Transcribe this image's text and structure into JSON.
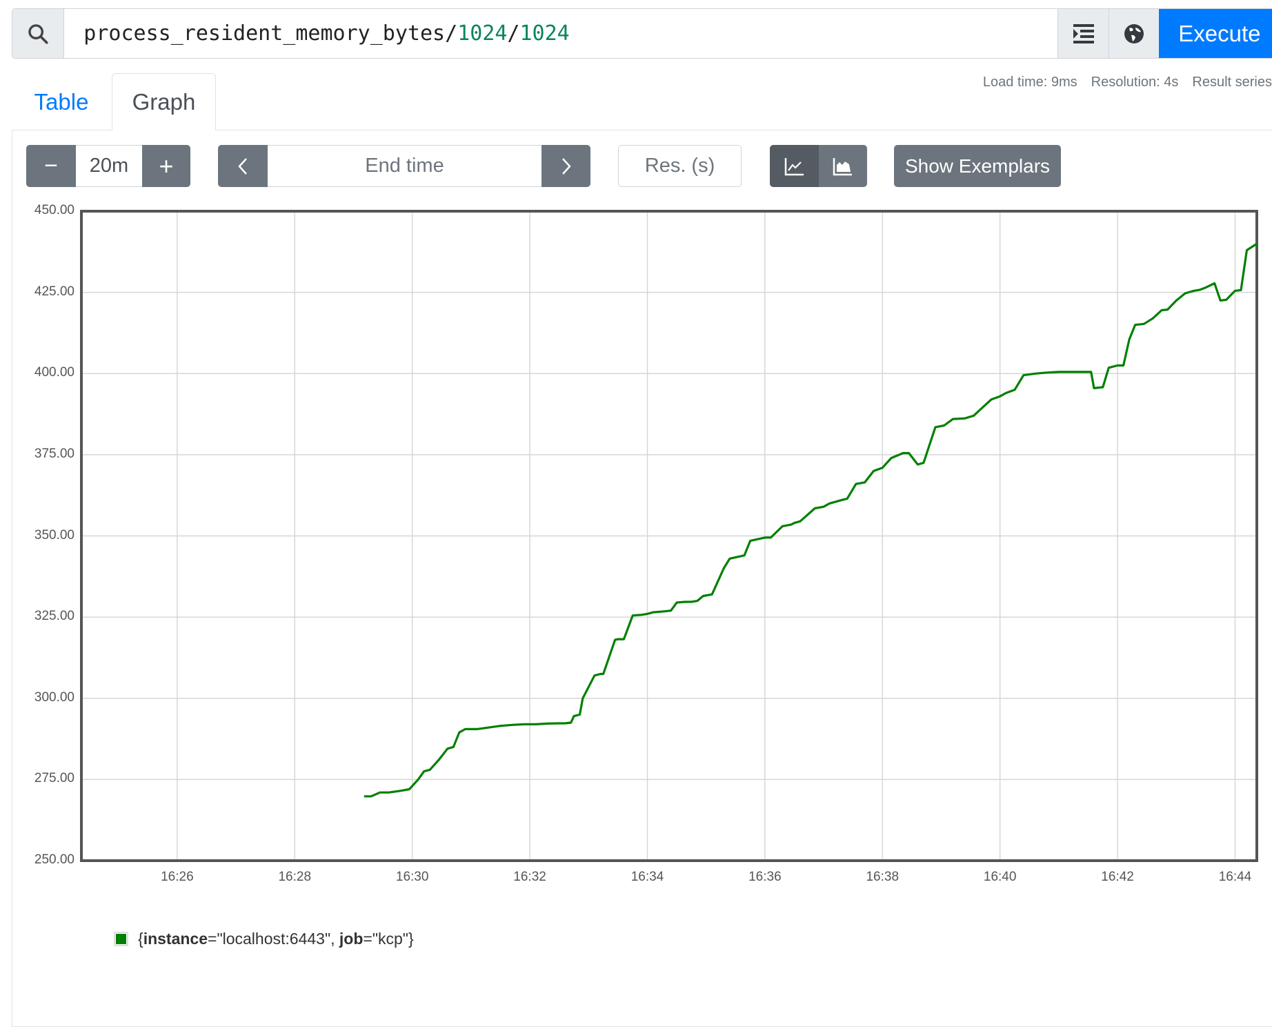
{
  "query": {
    "metric": "process_resident_memory_bytes",
    "op1": "/",
    "num1": "1024",
    "op2": "/",
    "num2": "1024",
    "execute_label": "Execute",
    "icons": [
      "search-icon",
      "format-icon",
      "globe-icon"
    ]
  },
  "stats": {
    "load_time": "Load time: 9ms",
    "resolution": "Resolution: 4s",
    "result_series": "Result series"
  },
  "tabs": [
    {
      "label": "Table",
      "active": false
    },
    {
      "label": "Graph",
      "active": true
    }
  ],
  "toolbar": {
    "range_minus": "−",
    "range_value": "20m",
    "range_plus": "+",
    "prev": "‹",
    "end_time_placeholder": "End time",
    "next": "›",
    "res_placeholder": "Res. (s)",
    "show_exemplars": "Show Exemplars",
    "chart_modes": [
      "line-chart-icon",
      "stacked-area-icon"
    ]
  },
  "legend": {
    "color": "#008000",
    "open": "{",
    "k1": "instance",
    "v1": "=\"localhost:6443\", ",
    "k2": "job",
    "v2": "=\"kcp\"}"
  },
  "chart_data": {
    "type": "line",
    "title": "",
    "xlabel": "",
    "ylabel": "",
    "ylim": [
      250,
      450
    ],
    "yticks": [
      "450.00",
      "425.00",
      "400.00",
      "375.00",
      "350.00",
      "325.00",
      "300.00",
      "275.00",
      "250.00"
    ],
    "xlim_minutes": [
      984.37,
      1004.37
    ],
    "xticks": [
      "16:26",
      "16:28",
      "16:30",
      "16:32",
      "16:34",
      "16:36",
      "16:38",
      "16:40",
      "16:42",
      "16:44"
    ],
    "grid": true,
    "series": [
      {
        "name": "{instance=\"localhost:6443\", job=\"kcp\"}",
        "color": "#008000",
        "x_minutes": [
          989.18,
          989.3,
          989.45,
          989.6,
          989.8,
          989.95,
          990.1,
          990.2,
          990.3,
          990.45,
          990.6,
          990.7,
          990.8,
          990.9,
          991.1,
          991.3,
          991.5,
          991.7,
          991.9,
          992.1,
          992.3,
          992.5,
          992.6,
          992.7,
          992.75,
          992.85,
          992.9,
          993.1,
          993.2,
          993.25,
          993.45,
          993.5,
          993.6,
          993.75,
          993.9,
          994.0,
          994.1,
          994.3,
          994.4,
          994.5,
          994.65,
          994.75,
          994.85,
          994.95,
          995.1,
          995.3,
          995.4,
          995.65,
          995.75,
          996.0,
          996.1,
          996.3,
          996.45,
          996.5,
          996.6,
          996.85,
          997.0,
          997.1,
          997.3,
          997.4,
          997.55,
          997.7,
          997.85,
          998.0,
          998.15,
          998.35,
          998.45,
          998.6,
          998.7,
          998.9,
          999.05,
          999.2,
          999.4,
          999.55,
          999.7,
          999.85,
          1000.0,
          1000.1,
          1000.25,
          1000.4,
          1000.6,
          1000.8,
          1001.0,
          1001.2,
          1001.4,
          1001.55,
          1001.6,
          1001.75,
          1001.85,
          1002.0,
          1002.1,
          1002.2,
          1002.3,
          1002.45,
          1002.6,
          1002.75,
          1002.85,
          1003.0,
          1003.15,
          1003.3,
          1003.4,
          1003.5,
          1003.65,
          1003.75,
          1003.85,
          1004.0,
          1004.1,
          1004.2,
          1004.37
        ],
        "values": [
          269.8,
          269.8,
          271,
          271,
          271.5,
          272,
          275,
          277.5,
          278,
          281,
          284.5,
          285,
          289.5,
          290.5,
          290.5,
          291,
          291.5,
          291.8,
          292,
          292,
          292.2,
          292.3,
          292.3,
          292.5,
          294.5,
          295,
          300,
          307,
          307.5,
          307.5,
          318,
          318.2,
          318.2,
          325.5,
          325.7,
          326,
          326.5,
          326.8,
          327,
          329.5,
          329.7,
          329.7,
          330,
          331.5,
          332,
          340,
          343,
          344,
          348.5,
          349.5,
          349.5,
          353,
          353.5,
          354,
          354.5,
          358.5,
          359,
          360,
          361,
          361.5,
          366,
          366.5,
          370,
          371,
          374,
          375.5,
          375.5,
          372,
          372.5,
          383.5,
          384,
          386,
          386.2,
          387,
          389.5,
          392,
          393,
          394,
          395,
          399.5,
          400,
          400.3,
          400.5,
          400.5,
          400.5,
          400.5,
          395.5,
          395.8,
          401.8,
          402.5,
          402.5,
          410.5,
          415,
          415.3,
          417,
          419.5,
          419.7,
          422.5,
          424.7,
          425.5,
          425.8,
          426.5,
          427.8,
          422.5,
          422.7,
          425.5,
          425.7,
          438,
          440
        ]
      }
    ]
  }
}
